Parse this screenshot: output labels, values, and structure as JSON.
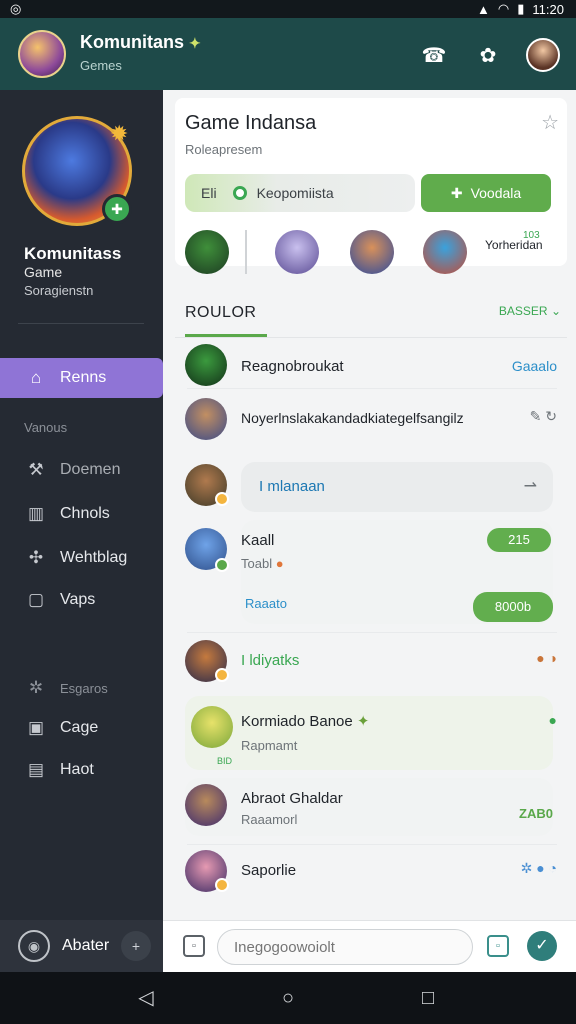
{
  "status_bar": {
    "time": "11:20",
    "left_icon": "notification-icon"
  },
  "app_bar": {
    "title": "Komunitans",
    "title_icon": "sparkle-icon",
    "subtitle": "Gemes",
    "actions": [
      "phone-icon",
      "group-icon",
      "profile-avatar"
    ]
  },
  "sidebar": {
    "profile_name": "Komunitass",
    "profile_line2": "Game",
    "profile_line3": "Soragienstn",
    "nav": [
      {
        "label": "Renns",
        "icon": "home-icon",
        "active": true
      },
      {
        "label": "Doemen",
        "icon": "wrench-icon"
      },
      {
        "label": "Chnols",
        "icon": "channel-icon"
      },
      {
        "label": "Wehtblag",
        "icon": "puzzle-icon"
      },
      {
        "label": "Vaps",
        "icon": "square-icon"
      },
      {
        "label": "Cage",
        "icon": "box-icon"
      },
      {
        "label": "Haot",
        "icon": "inbox-icon"
      }
    ],
    "section_1": "Vanous",
    "section_2": "Esgaros",
    "footer_label": "Abater"
  },
  "card": {
    "title": "Game Indansa",
    "subtitle": "Roleapresem",
    "pill_left_a": "Eli",
    "pill_left_b": "Keopomiista",
    "pill_right": "Voodala",
    "friends_tag": "Yorheridan",
    "friends_tag_num": "103"
  },
  "tabs": {
    "active": "ROULOR",
    "filter": "BASSER"
  },
  "rows": [
    {
      "name": "Reagnobroukat",
      "meta": "Gaaalo"
    },
    {
      "name": "Noyerlnslakakandadkiategelfsangilz"
    },
    {
      "bubble_text": "I mlanaan"
    },
    {
      "name": "Kaall",
      "sub": "Toabl",
      "badge": "215",
      "link": "Raaato",
      "pill": "8000b"
    },
    {
      "name": "I ldiyatks"
    },
    {
      "name": "Kormiado Banoe",
      "sub": "Rapmamt",
      "tag": "BID"
    },
    {
      "name": "Abraot Ghaldar",
      "sub": "Raaamorl",
      "badge": "ZAB0"
    },
    {
      "name": "Saporlie"
    }
  ],
  "composer": {
    "placeholder": "Inegogoowoiolt"
  },
  "colors": {
    "accent": "#8f74d6",
    "green": "#60ac4c",
    "teal": "#1e4a49",
    "sidebar": "#252a33"
  }
}
